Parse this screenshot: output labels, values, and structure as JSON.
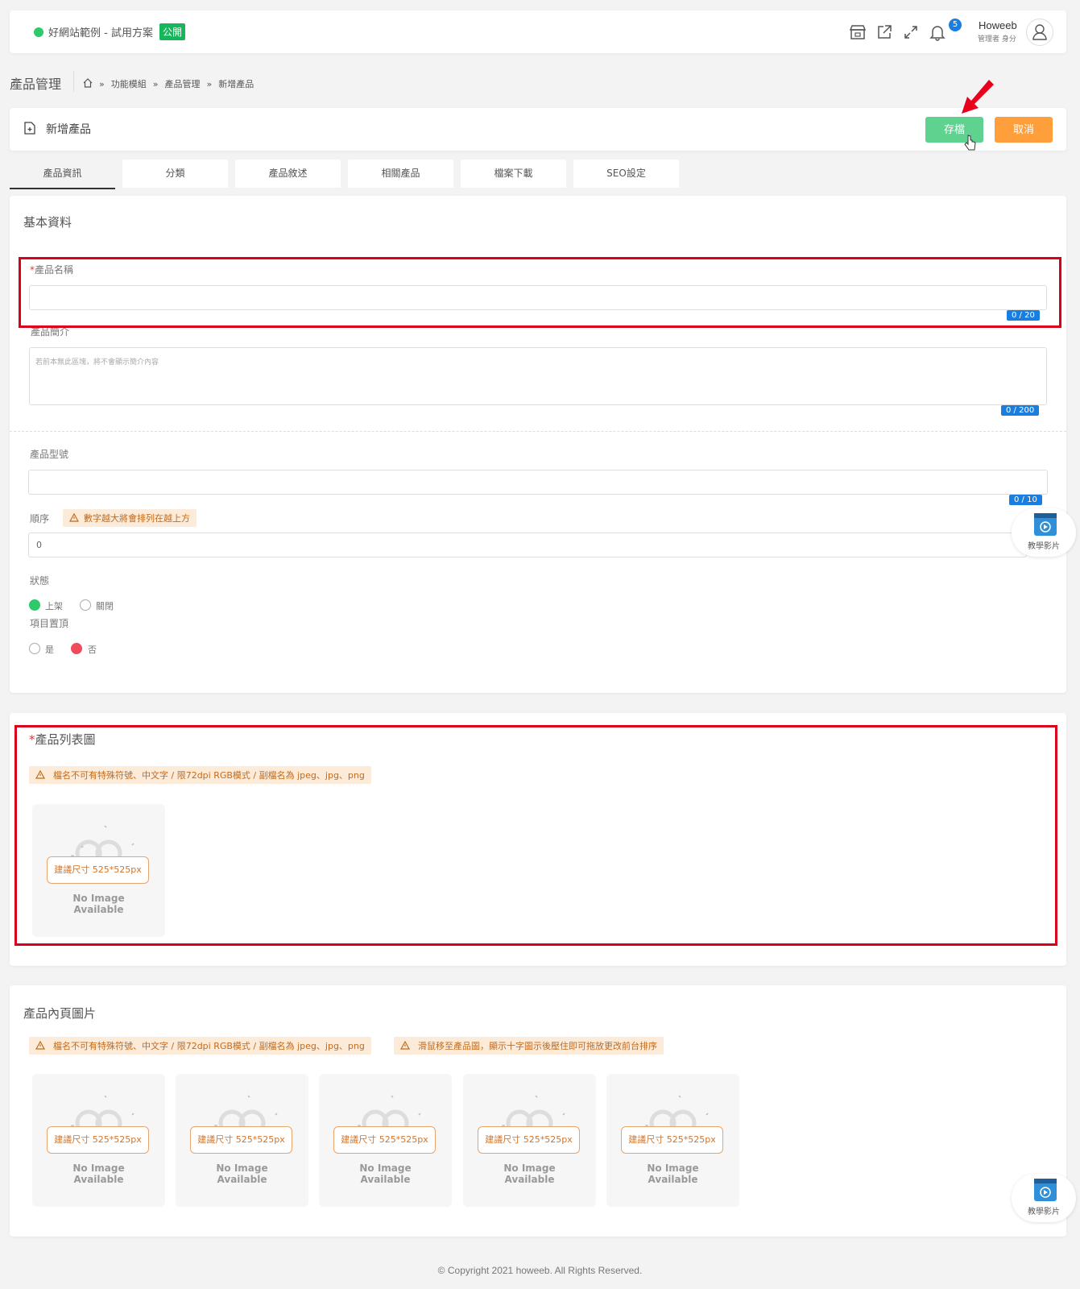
{
  "topbar": {
    "site_name": "好網站範例 - 試用方案",
    "site_badge": "公開",
    "notification_count": "5",
    "user_name": "Howeeb",
    "user_role": "管理者 身分",
    "status_color": "#2ec96a"
  },
  "page": {
    "title": "產品管理",
    "breadcrumb": [
      "功能模組",
      "產品管理",
      "新增產品"
    ],
    "breadcrumb_sep": "»"
  },
  "header": {
    "title": "新增產品",
    "save_label": "存檔",
    "cancel_label": "取消"
  },
  "tabs": [
    "產品資訊",
    "分類",
    "產品敘述",
    "相關產品",
    "檔案下載",
    "SEO設定"
  ],
  "basic": {
    "section_title": "基本資料",
    "name_label": "產品名稱",
    "name_counter": "0 / 20",
    "intro_label": "產品簡介",
    "intro_placeholder": "若前本無此區塊，將不會顯示簡介內容",
    "intro_counter": "0 / 200",
    "model_label": "產品型號",
    "model_counter": "0 / 10",
    "order_label": "順序",
    "order_warning": "數字越大將會排列在越上方",
    "order_value": "0",
    "status_label": "狀態",
    "status_on": "上架",
    "status_off": "關閉",
    "top_label": "項目置頂",
    "top_yes": "是",
    "top_no": "否"
  },
  "list_image": {
    "title": "產品列表圖",
    "warning": "檔名不可有特殊符號、中文字 / 限72dpi RGB模式 / 副檔名為 jpeg、jpg、png",
    "size_hint": "建議尺寸 525*525px",
    "no_image_line1": "No Image",
    "no_image_line2": "Available"
  },
  "inner_images": {
    "title": "產品內頁圖片",
    "warning": "檔名不可有特殊符號、中文字 / 限72dpi RGB模式 / 副檔名為 jpeg、jpg、png",
    "warning2": "滑鼠移至產品圖，顯示十字圖示後壓住即可拖放更改前台排序",
    "size_hint": "建議尺寸 525*525px",
    "no_image_line1": "No Image",
    "no_image_line2": "Available"
  },
  "help": {
    "video_label": "教學影片"
  },
  "footer": {
    "copyright": "© Copyright 2021 howeeb. All Rights Reserved."
  },
  "colors": {
    "save": "#5fd290",
    "cancel": "#ff9f3c",
    "counter": "#1a7ee0",
    "highlight": "#d9001b"
  }
}
